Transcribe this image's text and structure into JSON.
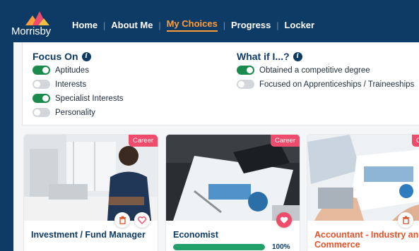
{
  "header": {
    "logo_text": "Morrisby",
    "nav": [
      {
        "label": "Home",
        "active": false
      },
      {
        "label": "About Me",
        "active": false
      },
      {
        "label": "My Choices",
        "active": true
      },
      {
        "label": "Progress",
        "active": false
      },
      {
        "label": "Locker",
        "active": false
      }
    ]
  },
  "focus_on": {
    "title": "Focus On",
    "items": [
      {
        "label": "Aptitudes",
        "on": true
      },
      {
        "label": "Interests",
        "on": false
      },
      {
        "label": "Specialist Interests",
        "on": true
      },
      {
        "label": "Personality",
        "on": false
      }
    ]
  },
  "what_if": {
    "title": "What if I...?",
    "items": [
      {
        "label": "Obtained a competitive degree",
        "on": true
      },
      {
        "label": "Focused on Apprenticeships / Traineeships",
        "on": false
      }
    ]
  },
  "cards": [
    {
      "title": "Investment / Fund Manager",
      "badge": "Career",
      "favorited": false,
      "progress": null
    },
    {
      "title": "Economist",
      "badge": "Career",
      "favorited": true,
      "progress": 100,
      "progress_label": "100%"
    },
    {
      "title": "Accountant - Industry and Commerce",
      "badge": "Career",
      "favorited": false,
      "progress": null
    }
  ],
  "colors": {
    "brand_navy": "#0e3b66",
    "accent_orange": "#ff9d3b",
    "toggle_on": "#1a8a4d",
    "badge_pink": "#ee4b6d"
  }
}
